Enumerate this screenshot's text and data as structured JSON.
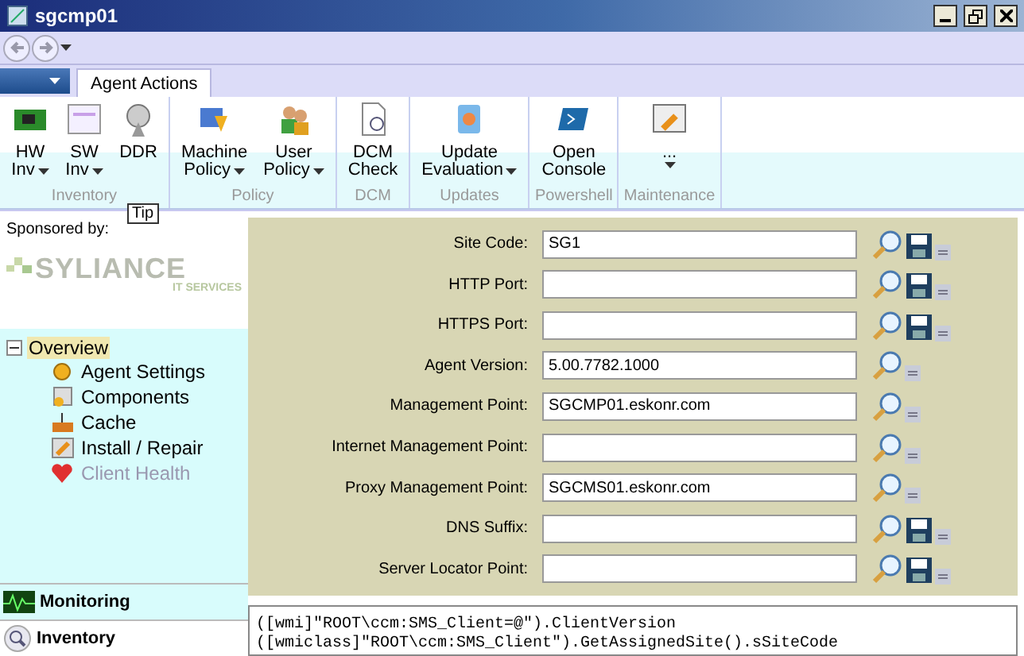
{
  "window": {
    "title": "sgcmp01"
  },
  "tabs": [
    {
      "label": "Agent Actions",
      "selected": true
    }
  ],
  "ribbon_groups": [
    {
      "label": "Inventory",
      "buttons": [
        {
          "lines": [
            "HW",
            "Inv"
          ],
          "dropdown": true
        },
        {
          "lines": [
            "SW",
            "Inv"
          ],
          "dropdown": true
        },
        {
          "lines": [
            "DDR"
          ],
          "dropdown": false
        }
      ]
    },
    {
      "label": "Policy",
      "buttons": [
        {
          "lines": [
            "Machine",
            "Policy"
          ],
          "dropdown": true
        },
        {
          "lines": [
            "User",
            "Policy"
          ],
          "dropdown": true
        }
      ]
    },
    {
      "label": "DCM",
      "buttons": [
        {
          "lines": [
            "DCM",
            "Check"
          ],
          "dropdown": false
        }
      ]
    },
    {
      "label": "Updates",
      "buttons": [
        {
          "lines": [
            "Update",
            "Evaluation"
          ],
          "dropdown": true
        }
      ]
    },
    {
      "label": "Powershell",
      "buttons": [
        {
          "lines": [
            "Open",
            "Console"
          ],
          "dropdown": false
        }
      ]
    },
    {
      "label": "Maintenance",
      "buttons": [
        {
          "lines": [
            "..."
          ],
          "dropdown": true
        }
      ]
    }
  ],
  "tooltip": "Tip",
  "sponsor": {
    "caption": "Sponsored by:",
    "logo_name": "SYLIANCE",
    "logo_tagline": "IT SERVICES"
  },
  "tree": [
    {
      "label": "Overview",
      "expanded": true,
      "selected": true,
      "children": [
        {
          "label": "Agent Settings",
          "disabled": false
        },
        {
          "label": "Components",
          "disabled": false
        },
        {
          "label": "Cache",
          "disabled": false
        },
        {
          "label": "Install / Repair",
          "disabled": false
        },
        {
          "label": "Client Health",
          "disabled": true
        }
      ]
    }
  ],
  "nav_sections": [
    {
      "label": "Monitoring",
      "selected": true
    },
    {
      "label": "Inventory",
      "selected": false
    }
  ],
  "fields": [
    {
      "label": "Site Code:",
      "value": "SG1",
      "kind": "savable"
    },
    {
      "label": "HTTP Port:",
      "kind": "savable"
    },
    {
      "label": "HTTPS Port:",
      "kind": "savable"
    },
    {
      "label": "Agent Version:",
      "value": "5.00.7782.1000",
      "kind": "readonly"
    },
    {
      "label": "Management Point:",
      "value": "SGCMP01.eskonr.com",
      "kind": "readonly"
    },
    {
      "label": "Internet Management Point:",
      "kind": "readonly"
    },
    {
      "label": "Proxy Management Point:",
      "value": "SGCMS01.eskonr.com",
      "kind": "readonly"
    },
    {
      "label": "DNS Suffix:",
      "kind": "savable"
    },
    {
      "label": "Server Locator Point:",
      "kind": "savable"
    }
  ],
  "script_lines": [
    "([wmi]\"ROOT\\ccm:SMS_Client=@\").ClientVersion",
    "([wmiclass]\"ROOT\\ccm:SMS_Client\").GetAssignedSite().sSiteCode"
  ]
}
